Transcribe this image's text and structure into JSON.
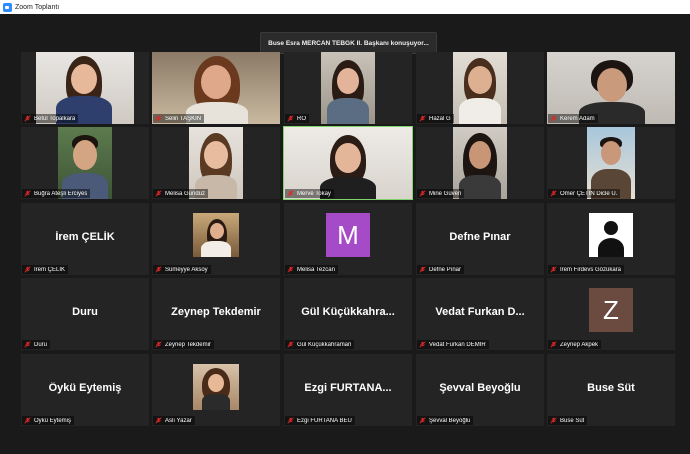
{
  "window": {
    "title": "Zoom Toplantı"
  },
  "speaker_banner": "Buse Esra MERCAN TEBGK II. Başkanı konuşuyor...",
  "participants": [
    {
      "name": "Betül Topalkara"
    },
    {
      "name": "Selin TAŞKIN"
    },
    {
      "name": "RÖ"
    },
    {
      "name": "Hazal G"
    },
    {
      "name": "Kerem Adam"
    },
    {
      "name": "Buğra Ateşli Erciyes"
    },
    {
      "name": "Melisa Gündüz"
    },
    {
      "name": "Merve Tokay"
    },
    {
      "name": "Mine Güven"
    },
    {
      "name": "Ömer ÇETİN Dicle Ü."
    },
    {
      "name": "İrem ÇELİK",
      "display": "İrem ÇELİK"
    },
    {
      "name": "Sümeyye Aksoy"
    },
    {
      "name": "Melisa Tezcan",
      "avatar_letter": "M",
      "avatar_color": "#a54bc7"
    },
    {
      "name": "Defne Pınar",
      "display": "Defne Pınar"
    },
    {
      "name": "İrem Firdevs Gözükara"
    },
    {
      "name": "Duru",
      "display": "Duru"
    },
    {
      "name": "Zeynep Tekdemir",
      "display": "Zeynep Tekdemir"
    },
    {
      "name": "Gül Küçükkahraman",
      "display": "Gül Küçükkahra..."
    },
    {
      "name": "Vedat Furkan DEMİR",
      "display": "Vedat Furkan D..."
    },
    {
      "name": "Zeynep Akpek",
      "avatar_letter": "Z",
      "avatar_color": "#6b4a3f"
    },
    {
      "name": "Öykü Eytemiş",
      "display": "Öykü Eytemiş"
    },
    {
      "name": "Aslı Yazar"
    },
    {
      "name": "Ezgi FURTANA BEU",
      "display": "Ezgi FURTANA..."
    },
    {
      "name": "Şevval Beyoğlu",
      "display": "Şevval Beyoğlu"
    },
    {
      "name": "Buse Süt",
      "display": "Buse Süt"
    }
  ],
  "icons": {
    "muted_mic": "muted-mic-icon",
    "app": "zoom-app-icon"
  },
  "colors": {
    "tile_bg": "#242424",
    "stage_bg": "#1a1a1a",
    "mute_red": "#e02828",
    "active_outline": "#7fd36a"
  }
}
